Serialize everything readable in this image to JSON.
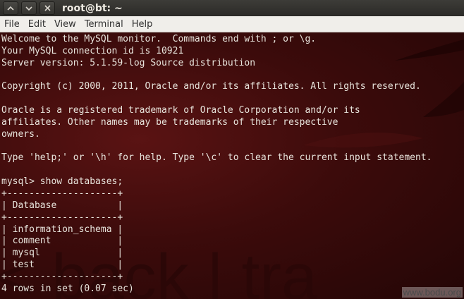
{
  "window": {
    "title": "root@bt: ~",
    "buttons": [
      "minimize",
      "maximize",
      "close"
    ]
  },
  "menu": [
    "File",
    "Edit",
    "View",
    "Terminal",
    "Help"
  ],
  "terminal": {
    "lines": [
      "Welcome to the MySQL monitor.  Commands end with ; or \\g.",
      "Your MySQL connection id is 10921",
      "Server version: 5.1.59-log Source distribution",
      "",
      "Copyright (c) 2000, 2011, Oracle and/or its affiliates. All rights reserved.",
      "",
      "Oracle is a registered trademark of Oracle Corporation and/or its",
      "affiliates. Other names may be trademarks of their respective",
      "owners.",
      "",
      "Type 'help;' or '\\h' for help. Type '\\c' to clear the current input statement.",
      "",
      "mysql> show databases;",
      "+--------------------+",
      "| Database           |",
      "+--------------------+",
      "| information_schema |",
      "| comment            |",
      "| mysql              |",
      "| test               |",
      "+--------------------+",
      "4 rows in set (0.07 sec)"
    ],
    "background_text": "< back | tra",
    "watermark": "www.bodu.org"
  },
  "colors": {
    "terminal_bg": "#3a0b0b",
    "terminal_fg": "#e8e4dc",
    "titlebar_bg": "#2b2a27",
    "menubar_bg": "#f0eeea"
  }
}
